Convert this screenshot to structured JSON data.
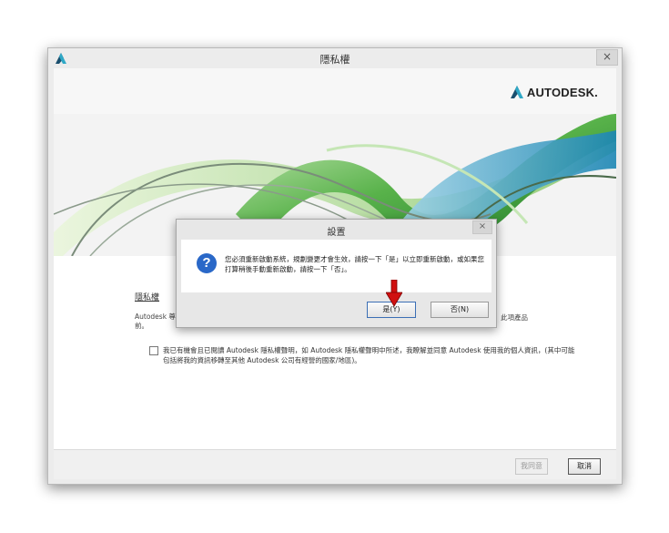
{
  "window": {
    "title": "隱私權",
    "close_label": "×"
  },
  "header": {
    "brand": "AUTODESK."
  },
  "main": {
    "section_title": "隱私權",
    "body_text": "Autodesk 尊",
    "body_text_2": "前。",
    "body_text_right": "此項產品",
    "consent_text": "我已有機會且已閱讀 Autodesk 隱私權聲明，如 Autodesk 隱私權聲明中所述，我瞭解並同意 Autodesk 使用我的個人資訊，(其中可能包括將我的資訊移轉至其他 Autodesk 公司有經營的國家/地區)。"
  },
  "footer": {
    "agree_label": "我同意",
    "cancel_label": "取消"
  },
  "dialog": {
    "title": "設置",
    "close_label": "×",
    "icon": "question-icon",
    "message": "您必須重新啟動系統，規劃變更才會生效，請按一下「是」以立即重新啟動，或如果您打算稍後手動重新啟動，請按一下「否」。",
    "yes_label": "是(Y)",
    "no_label": "否(N)"
  },
  "colors": {
    "accent": "#2a68c8",
    "arrow": "#d01010"
  }
}
